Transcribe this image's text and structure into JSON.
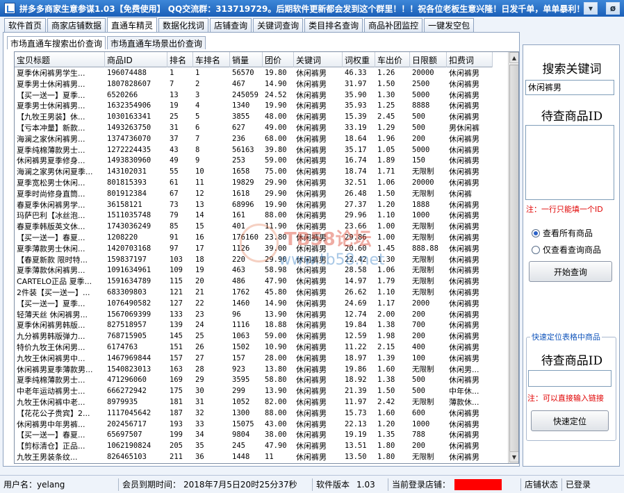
{
  "window": {
    "title": "拼多多商家生意参谋1.03【免费使用】 QQ交流群：313719729。后期软件更新都会发到这个群里！！！祝各位老板生意兴隆！日发千单，单单暴利！",
    "minimize_glyph": "▾",
    "close_glyph": "ø"
  },
  "tabs": [
    "软件首页",
    "商家店铺数据",
    "直通车精灵",
    "数据化找词",
    "店铺查询",
    "关键词查询",
    "类目排名查询",
    "商品补团监控",
    "一键发空包"
  ],
  "active_tab": 2,
  "subtabs": [
    "市场直通车搜索出价查询",
    "市场直通车场景出价查询"
  ],
  "active_subtab": 0,
  "table": {
    "columns": [
      "宝贝标题",
      "商品ID",
      "排名",
      "车排名",
      "销量",
      "团价",
      "关键词",
      "词权重",
      "车出价",
      "日限额",
      "扣费词"
    ],
    "rows": [
      [
        "夏季休闲裤男学生...",
        "196074488",
        "1",
        "1",
        "56570",
        "19.80",
        "休闲裤男",
        "46.33",
        "1.26",
        "20000",
        "休闲裤男"
      ],
      [
        "夏季男士休闲裤男...",
        "1807828607",
        "7",
        "2",
        "467",
        "14.90",
        "休闲裤男",
        "31.97",
        "1.50",
        "2500",
        "休闲裤男"
      ],
      [
        "【买一送一】夏季...",
        "6520266",
        "13",
        "3",
        "245059",
        "24.52",
        "休闲裤男",
        "35.90",
        "1.30",
        "5000",
        "休闲裤男"
      ],
      [
        "夏季男士休闲裤男...",
        "1632354906",
        "19",
        "4",
        "1340",
        "19.90",
        "休闲裤男",
        "35.93",
        "1.25",
        "8888",
        "休闲裤男"
      ],
      [
        "【九牧王男装】休...",
        "1030163341",
        "25",
        "5",
        "3855",
        "48.00",
        "休闲裤男",
        "15.39",
        "2.45",
        "500",
        "休闲裤男"
      ],
      [
        "【亏本冲量】新款...",
        "1493263750",
        "31",
        "6",
        "627",
        "49.00",
        "休闲裤男",
        "33.19",
        "1.29",
        "500",
        "男休闲裤"
      ],
      [
        "海澜之家休闲裤男...",
        "1374736070",
        "37",
        "7",
        "236",
        "68.00",
        "休闲裤男",
        "18.64",
        "1.96",
        "200",
        "休闲裤男"
      ],
      [
        "夏季纯棉薄款男士...",
        "1272224435",
        "43",
        "8",
        "56163",
        "39.80",
        "休闲裤男",
        "35.17",
        "1.05",
        "5000",
        "休闲裤男"
      ],
      [
        "休闲裤男夏季修身...",
        "1493830960",
        "49",
        "9",
        "253",
        "59.00",
        "休闲裤男",
        "16.74",
        "1.89",
        "150",
        "休闲裤男"
      ],
      [
        "海澜之家男休闲夏季...",
        "143102031",
        "55",
        "10",
        "1658",
        "75.00",
        "休闲裤男",
        "18.74",
        "1.71",
        "无限制",
        "休闲裤男"
      ],
      [
        "夏季宽松男士休闲...",
        "801815393",
        "61",
        "11",
        "19829",
        "29.90",
        "休闲裤男",
        "32.51",
        "1.06",
        "20000",
        "休闲裤男"
      ],
      [
        "夏季时尚修身直筒...",
        "801912384",
        "67",
        "12",
        "1618",
        "29.90",
        "休闲裤男",
        "26.48",
        "1.50",
        "无限制",
        "休闲裤"
      ],
      [
        "春夏季休闲裤男学...",
        "36158121",
        "73",
        "13",
        "68996",
        "19.90",
        "休闲裤男",
        "27.37",
        "1.20",
        "1888",
        "休闲裤男"
      ],
      [
        "玛萨巴利【冰丝泡...",
        "1511035748",
        "79",
        "14",
        "161",
        "88.00",
        "休闲裤男",
        "29.96",
        "1.10",
        "1000",
        "休闲裤男"
      ],
      [
        "春夏季韩版英文休...",
        "1743036249",
        "85",
        "15",
        "401",
        "11.90",
        "休闲裤男",
        "23.66",
        "1.00",
        "无限制",
        "休闲裤男"
      ],
      [
        "【买一送一】春夏...",
        "1208220",
        "91",
        "16",
        "176160",
        "23.80",
        "休闲裤男",
        "29.86",
        "1.00",
        "无限制",
        "休闲裤男"
      ],
      [
        "夏季薄款男士休闲...",
        "1420703168",
        "97",
        "17",
        "1126",
        "39.00",
        "休闲裤男",
        "20.60",
        "1.45",
        "888.88",
        "休闲裤男"
      ],
      [
        "【春夏新款 限时特...",
        "159837197",
        "103",
        "18",
        "220",
        "29.90",
        "休闲裤男",
        "22.42",
        "1.30",
        "无限制",
        "休闲裤男"
      ],
      [
        "夏季薄款休闲裤男...",
        "1091634961",
        "109",
        "19",
        "463",
        "58.98",
        "休闲裤男",
        "28.58",
        "1.06",
        "无限制",
        "休闲裤男"
      ],
      [
        "CARTELO正品 夏季...",
        "1591634789",
        "115",
        "20",
        "486",
        "47.90",
        "休闲裤男",
        "14.97",
        "1.79",
        "无限制",
        "休闲裤男"
      ],
      [
        "2件装【买一送一】...",
        "683309803",
        "121",
        "21",
        "1762",
        "45.80",
        "休闲裤男",
        "26.62",
        "1.10",
        "无限制",
        "休闲裤男"
      ],
      [
        "【买一送一】夏季...",
        "1076490582",
        "127",
        "22",
        "1460",
        "14.90",
        "休闲裤男",
        "24.69",
        "1.17",
        "2000",
        "休闲裤男"
      ],
      [
        "轻薄天丝 休闲裤男...",
        "1567069399",
        "133",
        "23",
        "96",
        "13.90",
        "休闲裤男",
        "12.74",
        "2.00",
        "200",
        "休闲裤男"
      ],
      [
        "夏季休闲裤男韩版...",
        "827518957",
        "139",
        "24",
        "1116",
        "18.88",
        "休闲裤男",
        "19.84",
        "1.38",
        "700",
        "休闲裤男"
      ],
      [
        "九分裤男韩版弹力...",
        "768715905",
        "145",
        "25",
        "1063",
        "59.00",
        "休闲裤男",
        "12.59",
        "1.98",
        "200",
        "休闲裤男"
      ],
      [
        "特价九牧王休闲男...",
        "6174763",
        "151",
        "26",
        "1502",
        "10.90",
        "休闲裤男",
        "11.22",
        "2.15",
        "400",
        "休闲裤男"
      ],
      [
        "九牧王休闲裤男中...",
        "1467969844",
        "157",
        "27",
        "157",
        "28.00",
        "休闲裤男",
        "18.97",
        "1.39",
        "100",
        "休闲裤男"
      ],
      [
        "休闲裤男夏季薄款男...",
        "1540823013",
        "163",
        "28",
        "923",
        "13.80",
        "休闲裤男",
        "19.86",
        "1.60",
        "无限制",
        "休闲男..."
      ],
      [
        "夏季纯棉薄款男士...",
        "471296060",
        "169",
        "29",
        "3595",
        "58.80",
        "休闲裤男",
        "18.92",
        "1.38",
        "500",
        "休闲裤男"
      ],
      [
        "中老年运动裤男士...",
        "666272942",
        "175",
        "30",
        "299",
        "13.90",
        "休闲裤男",
        "21.39",
        "1.50",
        "500",
        "中年休..."
      ],
      [
        "九牧王休闲裤中老...",
        "8979935",
        "181",
        "31",
        "1052",
        "82.00",
        "休闲裤男",
        "11.97",
        "2.42",
        "无限制",
        "薄款休..."
      ],
      [
        "【花花公子贵宾】2...",
        "1117045642",
        "187",
        "32",
        "1300",
        "88.00",
        "休闲裤男",
        "15.73",
        "1.60",
        "600",
        "休闲裤男"
      ],
      [
        "休闲裤男中年男裤...",
        "202456717",
        "193",
        "33",
        "15075",
        "43.00",
        "休闲裤男",
        "22.13",
        "1.20",
        "1000",
        "休闲裤男"
      ],
      [
        "【买一送一】春夏...",
        "65697507",
        "199",
        "34",
        "9804",
        "38.00",
        "休闲裤男",
        "19.19",
        "1.35",
        "788",
        "休闲裤男"
      ],
      [
        "【剪标清仓】正品...",
        "1062190824",
        "205",
        "35",
        "245",
        "47.90",
        "休闲裤男",
        "13.51",
        "1.80",
        "200",
        "休闲裤男"
      ],
      [
        "九牧王男装条纹...",
        "826465103",
        "211",
        "36",
        "1448",
        "11",
        "休闲裤男",
        "13.50",
        "1.80",
        "无限制",
        "休闲裤男"
      ]
    ]
  },
  "watermark": {
    "text": "TB58论坛",
    "url": "www.tb58.net"
  },
  "right_panel": {
    "search_keyword_title": "搜索关键词",
    "search_keyword_value": "休闲裤男",
    "item_id_title": "待查商品ID",
    "item_id_note": "注：一行只能填一个ID",
    "radio_all": "查看所有商品",
    "radio_only": "仅查看查询商品",
    "start_button": "开始查询",
    "locate_group_title": "快速定位表格中商品",
    "locate_title": "待查商品ID",
    "locate_note": "注：可以直接输入链接",
    "locate_button": "快速定位"
  },
  "status": {
    "user_label": "用户名：",
    "user_value": "yelang",
    "expire_label": "会员到期时间：",
    "expire_value": "2018年7月5日20时25分37秒",
    "version_label": "软件版本",
    "version_value": "1.03",
    "store_label": "当前登录店铺：",
    "store_value_color": "#ff0000",
    "store_state_label": "店铺状态",
    "store_state_value": "已登录"
  }
}
